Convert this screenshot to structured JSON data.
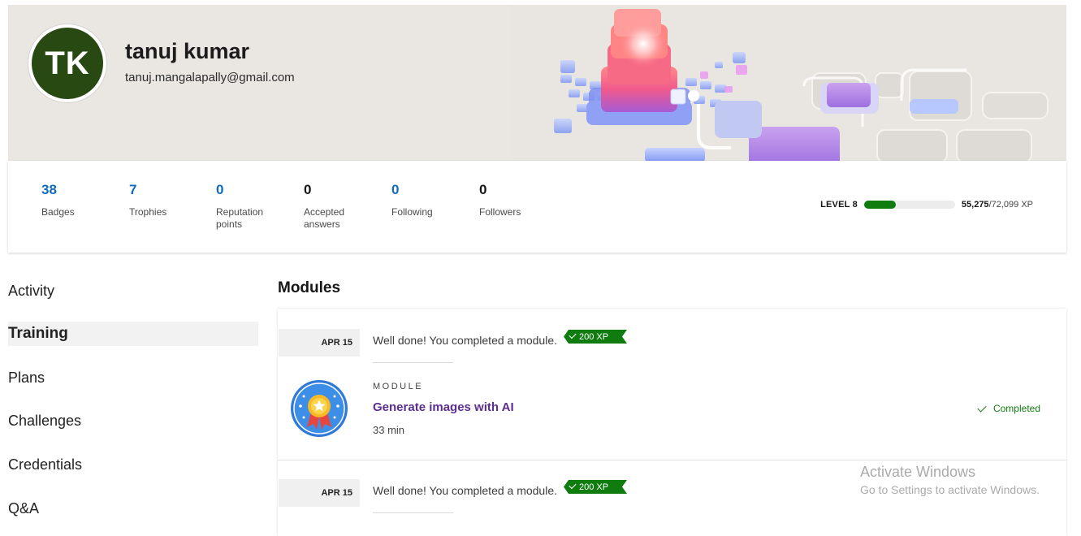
{
  "profile": {
    "initials": "TK",
    "name": "tanuj kumar",
    "email": "tanuj.mangalapally@gmail.com",
    "avatar_color": "#294912"
  },
  "stats": [
    {
      "value": "38",
      "label": "Badges",
      "color": "#0f6cbd"
    },
    {
      "value": "7",
      "label": "Trophies",
      "color": "#0f6cbd"
    },
    {
      "value": "0",
      "label": "Reputation points",
      "color": "#0f6cbd"
    },
    {
      "value": "0",
      "label": "Accepted answers",
      "color": "#161616"
    },
    {
      "value": "0",
      "label": "Following",
      "color": "#0f6cbd"
    },
    {
      "value": "0",
      "label": "Followers",
      "color": "#161616"
    }
  ],
  "level": {
    "label": "LEVEL 8",
    "xp_current": "55,275",
    "xp_total": "/72,099 XP",
    "progress_fraction": 0.35,
    "bar_color": "#107c10"
  },
  "nav": {
    "items": [
      {
        "label": "Activity",
        "active": false
      },
      {
        "label": "Training",
        "active": true
      },
      {
        "label": "Plans",
        "active": false
      },
      {
        "label": "Challenges",
        "active": false
      },
      {
        "label": "Credentials",
        "active": false
      },
      {
        "label": "Q&A",
        "active": false
      }
    ]
  },
  "modules": {
    "title": "Modules",
    "entries": [
      {
        "date": "APR 15",
        "message": "Well done! You completed a module.",
        "xp": "200 XP",
        "kicker": "MODULE",
        "module_title": "Generate images with AI",
        "duration": "33 min",
        "status": "Completed",
        "icon": "award-medal-icon"
      },
      {
        "date": "APR 15",
        "message": "Well done! You completed a module.",
        "xp": "200 XP"
      }
    ]
  },
  "watermark": {
    "title": "Activate Windows",
    "subtitle": "Go to Settings to activate Windows."
  }
}
